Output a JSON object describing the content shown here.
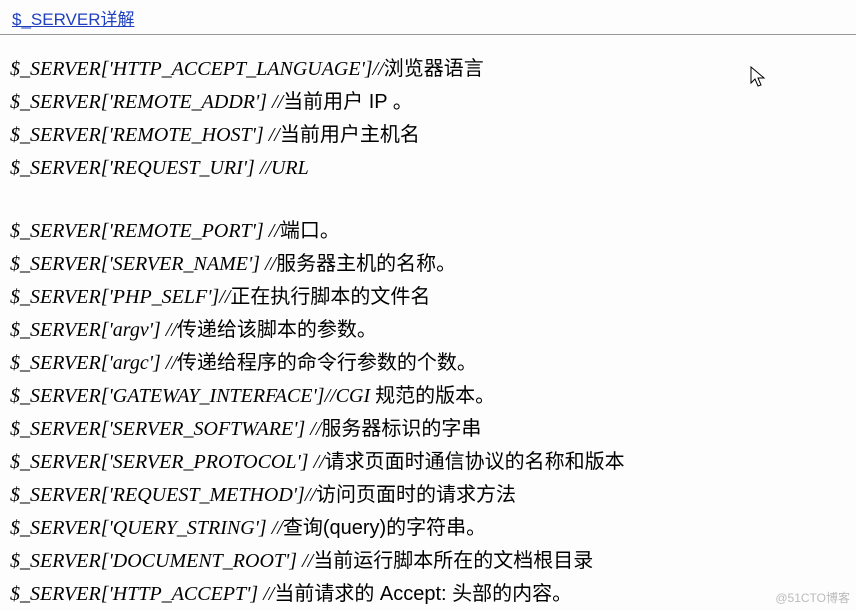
{
  "header": {
    "title_link": "$_SERVER详解"
  },
  "lines": {
    "l1_code": "$_SERVER['HTTP_ACCEPT_LANGUAGE']//",
    "l1_cn": "浏览器语言",
    "l2_code": "$_SERVER['REMOTE_ADDR'] //",
    "l2_cn": "当前用户 IP 。",
    "l3_code": "$_SERVER['REMOTE_HOST'] //",
    "l3_cn": "当前用户主机名",
    "l4_code": "$_SERVER['REQUEST_URI'] //URL",
    "l5_code": "$_SERVER['REMOTE_PORT'] //",
    "l5_cn": "端口。",
    "l6_code": "$_SERVER['SERVER_NAME'] //",
    "l6_cn": "服务器主机的名称。",
    "l7_code": "$_SERVER['PHP_SELF']//",
    "l7_cn": "正在执行脚本的文件名",
    "l8_code": "$_SERVER['argv'] //",
    "l8_cn": "传递给该脚本的参数。",
    "l9_code": "$_SERVER['argc'] //",
    "l9_cn": "传递给程序的命令行参数的个数。",
    "l10_code": "$_SERVER['GATEWAY_INTERFACE']//CGI ",
    "l10_cn": "规范的版本。",
    "l11_code": "$_SERVER['SERVER_SOFTWARE'] //",
    "l11_cn": "服务器标识的字串",
    "l12_code": "$_SERVER['SERVER_PROTOCOL'] //",
    "l12_cn": "请求页面时通信协议的名称和版本",
    "l13_code": "$_SERVER['REQUEST_METHOD']//",
    "l13_cn": "访问页面时的请求方法",
    "l14_code": "$_SERVER['QUERY_STRING'] //",
    "l14_cn": "查询(query)的字符串。",
    "l15_code": "$_SERVER['DOCUMENT_ROOT'] //",
    "l15_cn": "当前运行脚本所在的文档根目录",
    "l16_code": "$_SERVER['HTTP_ACCEPT'] //",
    "l16_cn": "当前请求的 Accept: 头部的内容。"
  },
  "watermark": "@51CTO博客"
}
